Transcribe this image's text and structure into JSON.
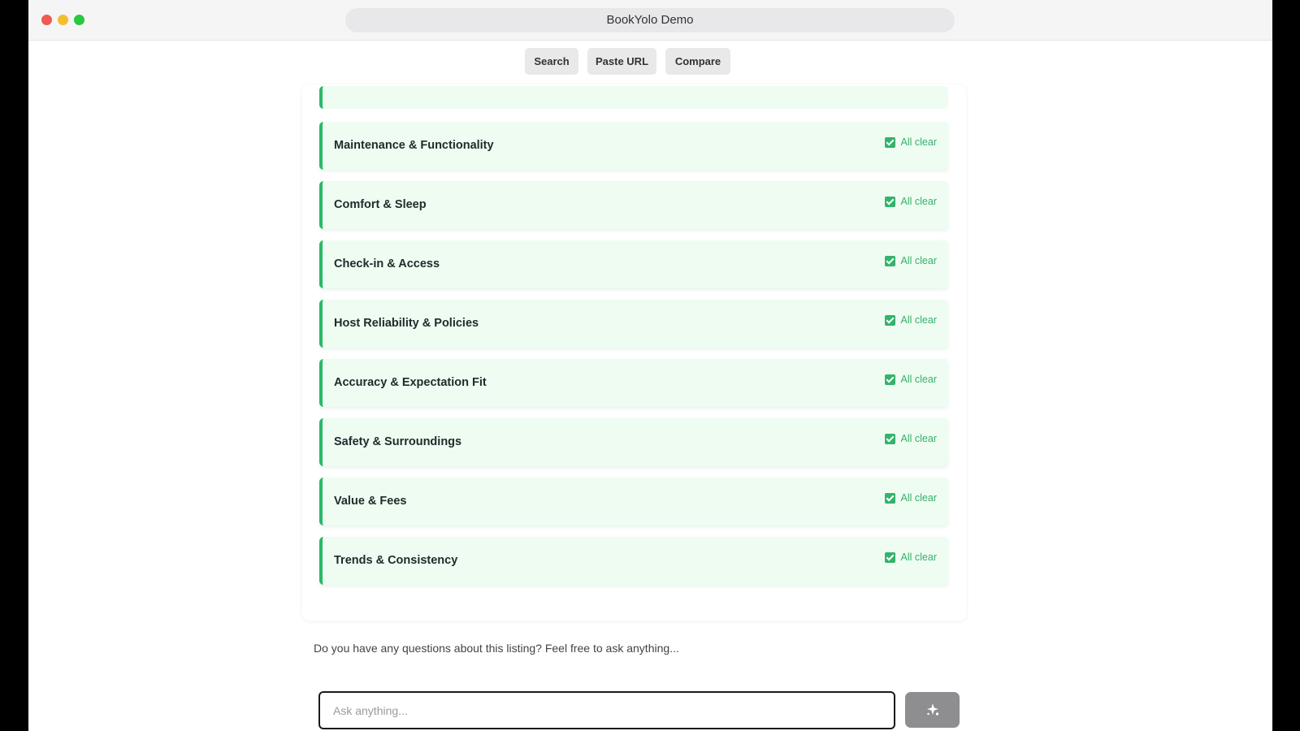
{
  "window": {
    "title": "BookYolo Demo"
  },
  "nav": {
    "search": "Search",
    "paste_url": "Paste URL",
    "compare": "Compare"
  },
  "categories": [
    {
      "label": "Maintenance & Functionality",
      "status": "All clear"
    },
    {
      "label": "Comfort & Sleep",
      "status": "All clear"
    },
    {
      "label": "Check-in & Access",
      "status": "All clear"
    },
    {
      "label": "Host Reliability & Policies",
      "status": "All clear"
    },
    {
      "label": "Accuracy & Expectation Fit",
      "status": "All clear"
    },
    {
      "label": "Safety & Surroundings",
      "status": "All clear"
    },
    {
      "label": "Value & Fees",
      "status": "All clear"
    },
    {
      "label": "Trends & Consistency",
      "status": "All clear"
    }
  ],
  "chat": {
    "prompt": "Do you have any questions about this listing? Feel free to ask anything...",
    "placeholder": "Ask anything..."
  },
  "icons": {
    "status": "checkbox-checked-icon",
    "send": "sparkle-icon"
  },
  "colors": {
    "accent_green": "#2bb868",
    "row_bg": "#effcf2",
    "send_button": "#8e8e91"
  }
}
